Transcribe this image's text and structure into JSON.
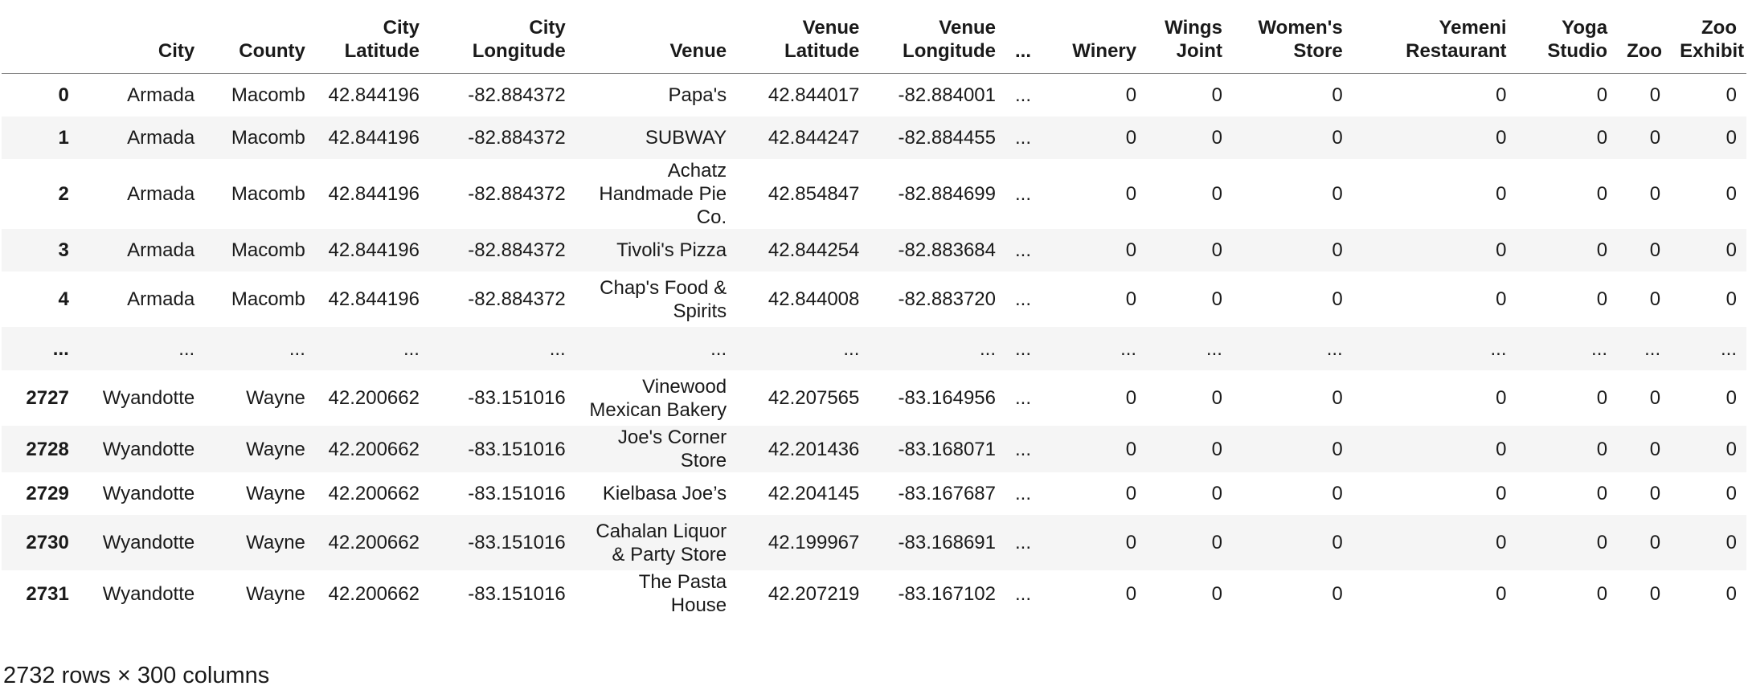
{
  "columns": [
    "",
    "City",
    "County",
    "City Latitude",
    "City Longitude",
    "Venue",
    "Venue Latitude",
    "Venue Longitude",
    "...",
    "Winery",
    "Wings Joint",
    "Women's Store",
    "Yemeni Restaurant",
    "Yoga Studio",
    "Zoo",
    "Zoo Exhibit"
  ],
  "rows": [
    {
      "index": "0",
      "cells": [
        "Armada",
        "Macomb",
        "42.844196",
        "-82.884372",
        "Papa's",
        "42.844017",
        "-82.884001",
        "...",
        "0",
        "0",
        "0",
        "0",
        "0",
        "0",
        "0"
      ]
    },
    {
      "index": "1",
      "cells": [
        "Armada",
        "Macomb",
        "42.844196",
        "-82.884372",
        "SUBWAY",
        "42.844247",
        "-82.884455",
        "...",
        "0",
        "0",
        "0",
        "0",
        "0",
        "0",
        "0"
      ]
    },
    {
      "index": "2",
      "cells": [
        "Armada",
        "Macomb",
        "42.844196",
        "-82.884372",
        "Achatz Handmade Pie Co.",
        "42.854847",
        "-82.884699",
        "...",
        "0",
        "0",
        "0",
        "0",
        "0",
        "0",
        "0"
      ]
    },
    {
      "index": "3",
      "cells": [
        "Armada",
        "Macomb",
        "42.844196",
        "-82.884372",
        "Tivoli's Pizza",
        "42.844254",
        "-82.883684",
        "...",
        "0",
        "0",
        "0",
        "0",
        "0",
        "0",
        "0"
      ]
    },
    {
      "index": "4",
      "cells": [
        "Armada",
        "Macomb",
        "42.844196",
        "-82.884372",
        "Chap's Food & Spirits",
        "42.844008",
        "-82.883720",
        "...",
        "0",
        "0",
        "0",
        "0",
        "0",
        "0",
        "0"
      ]
    },
    {
      "index": "...",
      "cells": [
        "...",
        "...",
        "...",
        "...",
        "...",
        "...",
        "...",
        "...",
        "...",
        "...",
        "...",
        "...",
        "...",
        "...",
        "..."
      ]
    },
    {
      "index": "2727",
      "cells": [
        "Wyandotte",
        "Wayne",
        "42.200662",
        "-83.151016",
        "Vinewood Mexican Bakery",
        "42.207565",
        "-83.164956",
        "...",
        "0",
        "0",
        "0",
        "0",
        "0",
        "0",
        "0"
      ]
    },
    {
      "index": "2728",
      "cells": [
        "Wyandotte",
        "Wayne",
        "42.200662",
        "-83.151016",
        "Joe's Corner Store",
        "42.201436",
        "-83.168071",
        "...",
        "0",
        "0",
        "0",
        "0",
        "0",
        "0",
        "0"
      ]
    },
    {
      "index": "2729",
      "cells": [
        "Wyandotte",
        "Wayne",
        "42.200662",
        "-83.151016",
        "Kielbasa Joe’s",
        "42.204145",
        "-83.167687",
        "...",
        "0",
        "0",
        "0",
        "0",
        "0",
        "0",
        "0"
      ]
    },
    {
      "index": "2730",
      "cells": [
        "Wyandotte",
        "Wayne",
        "42.200662",
        "-83.151016",
        "Cahalan Liquor & Party Store",
        "42.199967",
        "-83.168691",
        "...",
        "0",
        "0",
        "0",
        "0",
        "0",
        "0",
        "0"
      ]
    },
    {
      "index": "2731",
      "cells": [
        "Wyandotte",
        "Wayne",
        "42.200662",
        "-83.151016",
        "The Pasta House",
        "42.207219",
        "-83.167102",
        "...",
        "0",
        "0",
        "0",
        "0",
        "0",
        "0",
        "0"
      ]
    }
  ],
  "footer": "2732 rows × 300 columns"
}
